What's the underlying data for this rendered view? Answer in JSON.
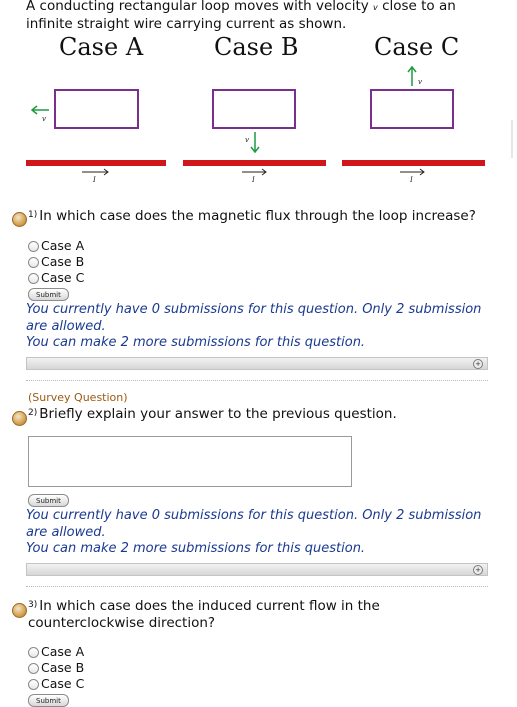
{
  "intro": {
    "text_before": "A conducting rectangular loop moves with velocity",
    "velocity_symbol": "v",
    "text_after": "close to an infinite straight wire carrying current as shown."
  },
  "figure": {
    "cases": [
      {
        "label": "Case A",
        "motion": "left",
        "velocity_label": "v",
        "current_label": "I"
      },
      {
        "label": "Case B",
        "motion": "down",
        "velocity_label": "v",
        "current_label": "I"
      },
      {
        "label": "Case C",
        "motion": "up",
        "velocity_label": "v",
        "current_label": "I"
      }
    ],
    "colors": {
      "loop": "#7a2f8f",
      "wire": "#d0161b",
      "arrow": "#1e9b40",
      "current_arrow": "#222222"
    }
  },
  "questions": [
    {
      "number": "1)",
      "text": "In which case does the magnetic flux through the loop increase?",
      "options": [
        "Case A",
        "Case B",
        "Case C"
      ],
      "submit_label": "Submit",
      "feedback_line1": "You currently have 0 submissions for this question. Only 2 submission are allowed.",
      "feedback_line2": "You can make 2 more submissions for this question."
    },
    {
      "tag": "(Survey Question)",
      "number": "2)",
      "text": "Briefly explain your answer to the previous question.",
      "submit_label": "Submit",
      "feedback_line1": "You currently have 0 submissions for this question. Only 2 submission are allowed.",
      "feedback_line2": "You can make 2 more submissions for this question."
    },
    {
      "number": "3)",
      "text": "In which case does the induced current flow in the counterclockwise direction?",
      "options": [
        "Case A",
        "Case B",
        "Case C"
      ],
      "submit_label": "Submit"
    }
  ]
}
